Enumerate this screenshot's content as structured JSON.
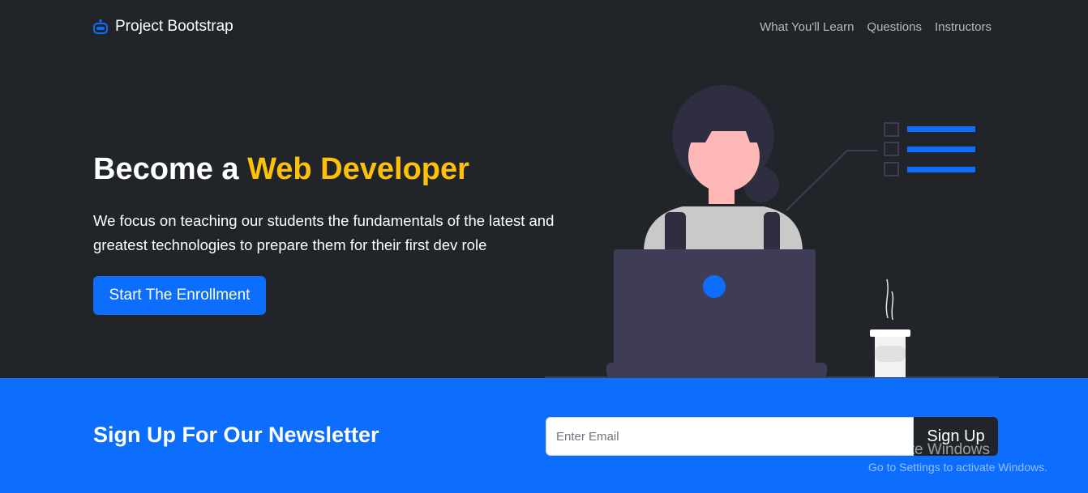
{
  "navbar": {
    "brand": "Project Bootstrap",
    "brand_icon": "robot-icon",
    "links": [
      "What You'll Learn",
      "Questions",
      "Instructors"
    ]
  },
  "hero": {
    "title_prefix": "Become a ",
    "title_accent": "Web Developer",
    "lead": "We focus on teaching our students the fundamentals of the latest and greatest technologies to prepare them for their first dev role",
    "button_label": "Start The Enrollment",
    "illustration": "developer-at-laptop-illustration"
  },
  "newsletter": {
    "title": "Sign Up For Our Newsletter",
    "email_placeholder": "Enter Email",
    "button_label": "Sign Up"
  },
  "watermark": {
    "title": "Activate Windows",
    "subtitle": "Go to Settings to activate Windows."
  },
  "colors": {
    "background_dark": "#212529",
    "primary": "#0d6efd",
    "accent": "#ffc107",
    "nav_link": "#b7b9bd"
  }
}
